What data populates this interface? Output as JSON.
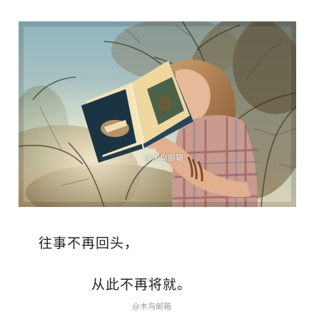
{
  "photo": {
    "alt": "girl reading a book under trees",
    "watermark": "@木鸟邮箱"
  },
  "caption": {
    "line1": "往事不再回头，",
    "line2": "从此不再将就。"
  },
  "footer": {
    "watermark": "@木鸟邮箱"
  }
}
